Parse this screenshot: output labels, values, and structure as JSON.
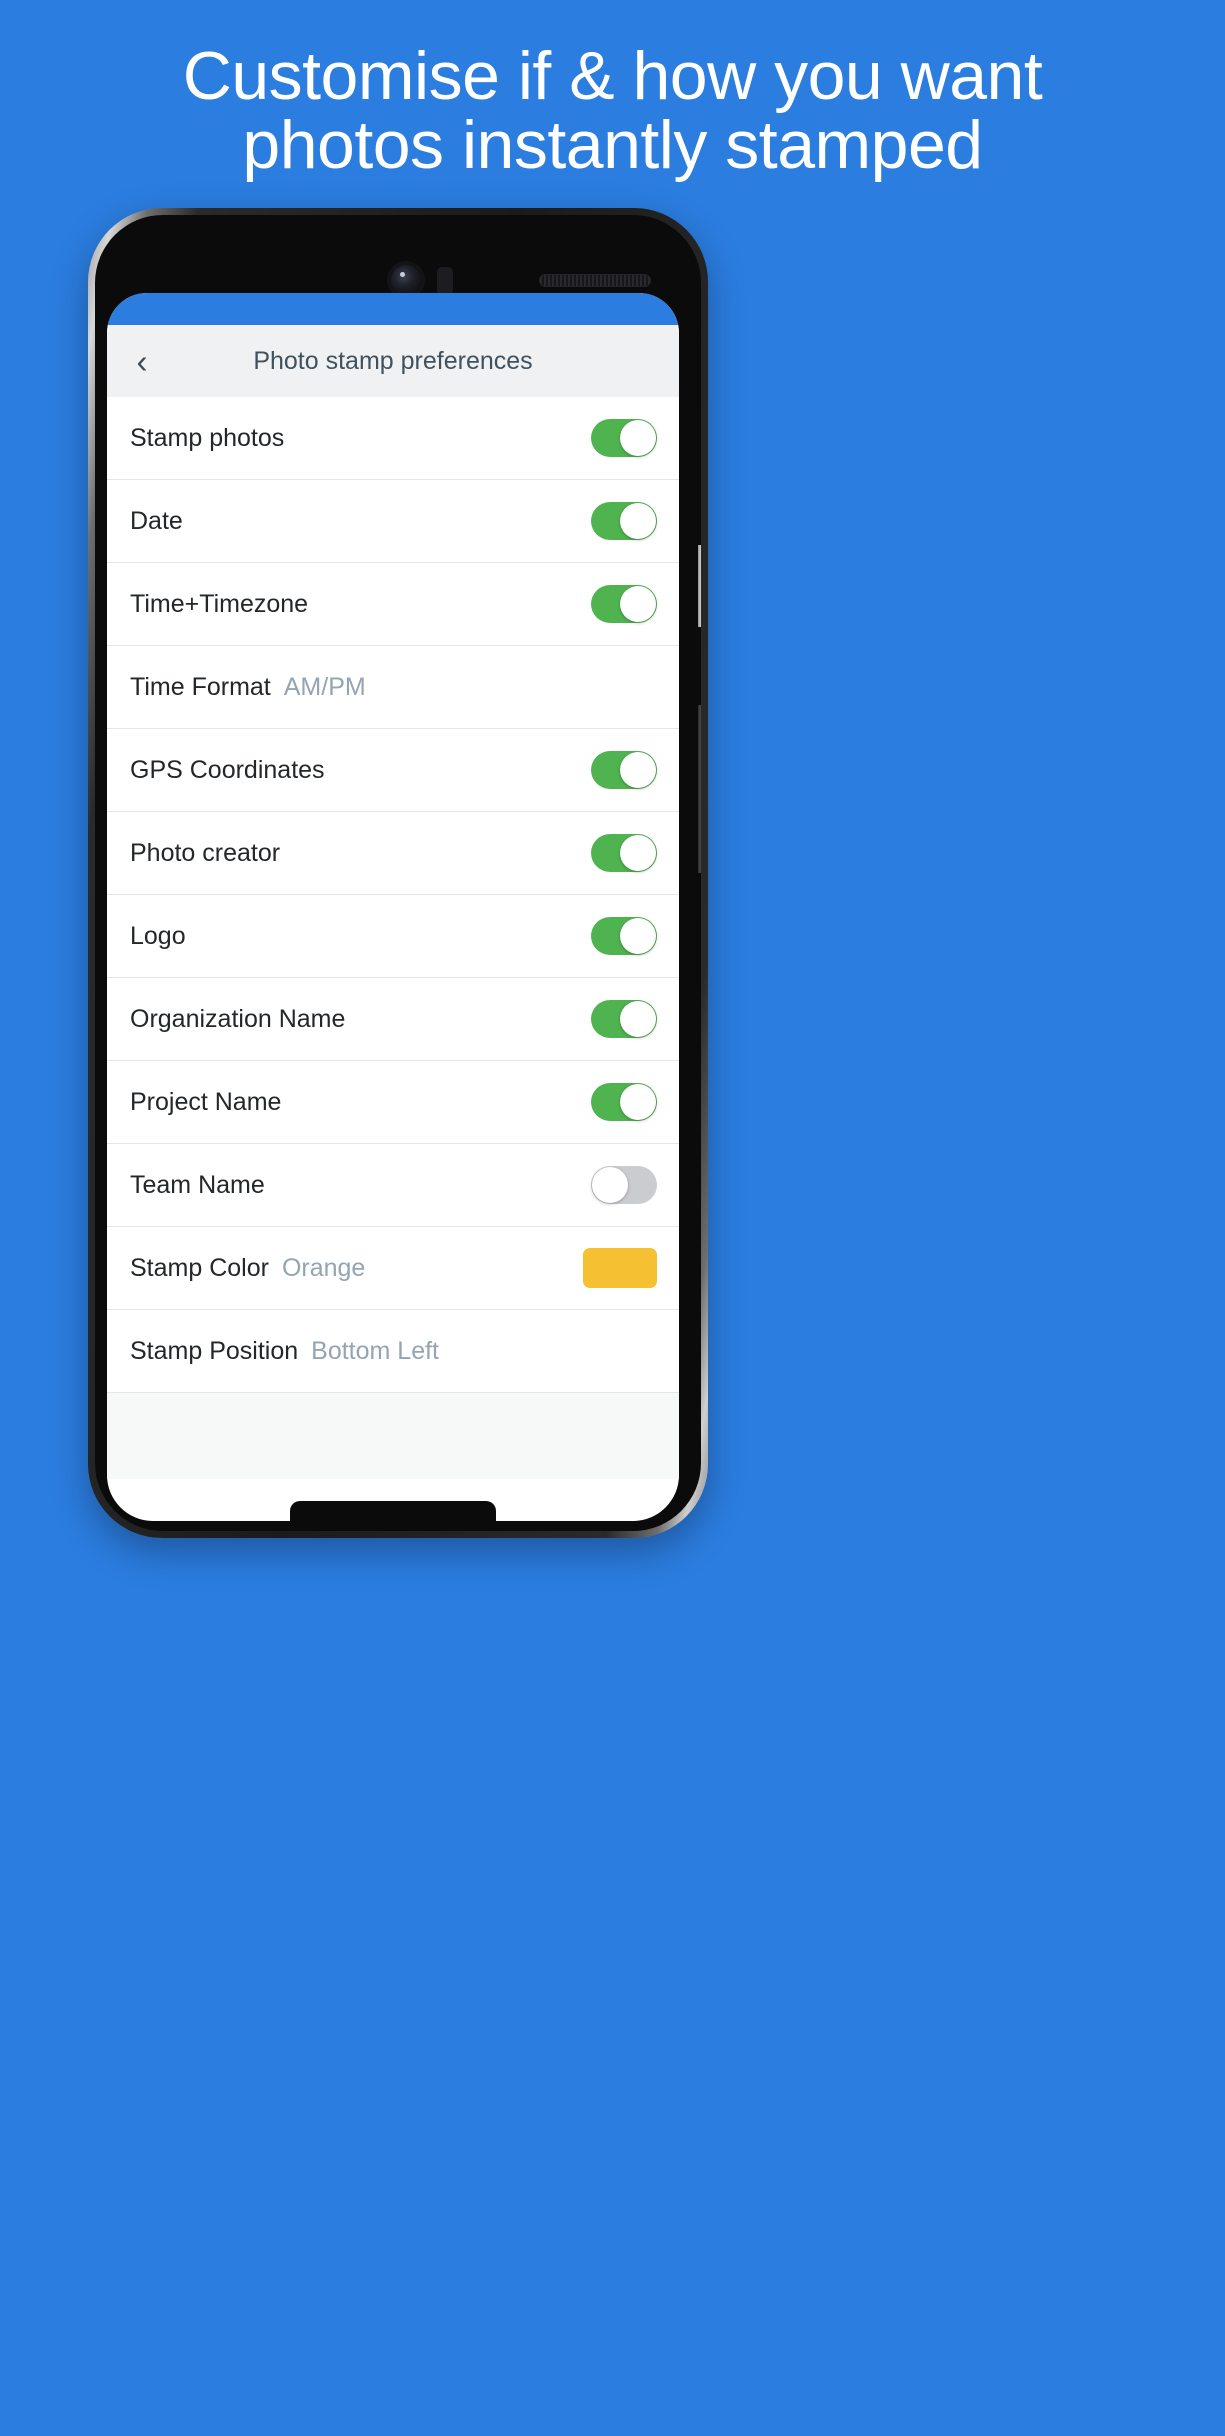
{
  "page": {
    "background_color": "#2b7de0",
    "headline_line1": "Customise if & how you want",
    "headline_line2": "photos instantly stamped"
  },
  "app": {
    "back_icon": "chevron-left-icon",
    "title": "Photo stamp preferences",
    "appbar_bg": "#f0f1f2",
    "toggle_on_color": "#4fb450",
    "toggle_off_color": "#c9cdd0",
    "value_text_color": "#93a4b4"
  },
  "settings": {
    "rows": [
      {
        "label": "Stamp photos",
        "control": "toggle",
        "state": "on"
      },
      {
        "label": "Date",
        "control": "toggle",
        "state": "on"
      },
      {
        "label": "Time+Timezone",
        "control": "toggle",
        "state": "on"
      },
      {
        "label": "Time Format",
        "control": "value",
        "value": "AM/PM"
      },
      {
        "label": "GPS Coordinates",
        "control": "toggle",
        "state": "on"
      },
      {
        "label": "Photo creator",
        "control": "toggle",
        "state": "on"
      },
      {
        "label": "Logo",
        "control": "toggle",
        "state": "on"
      },
      {
        "label": "Organization Name",
        "control": "toggle",
        "state": "on"
      },
      {
        "label": "Project Name",
        "control": "toggle",
        "state": "on"
      },
      {
        "label": "Team Name",
        "control": "toggle",
        "state": "off"
      },
      {
        "label": "Stamp Color",
        "control": "swatch",
        "value": "Orange",
        "swatch_color": "#f5c132"
      },
      {
        "label": "Stamp Position",
        "control": "value",
        "value": "Bottom Left"
      }
    ]
  }
}
